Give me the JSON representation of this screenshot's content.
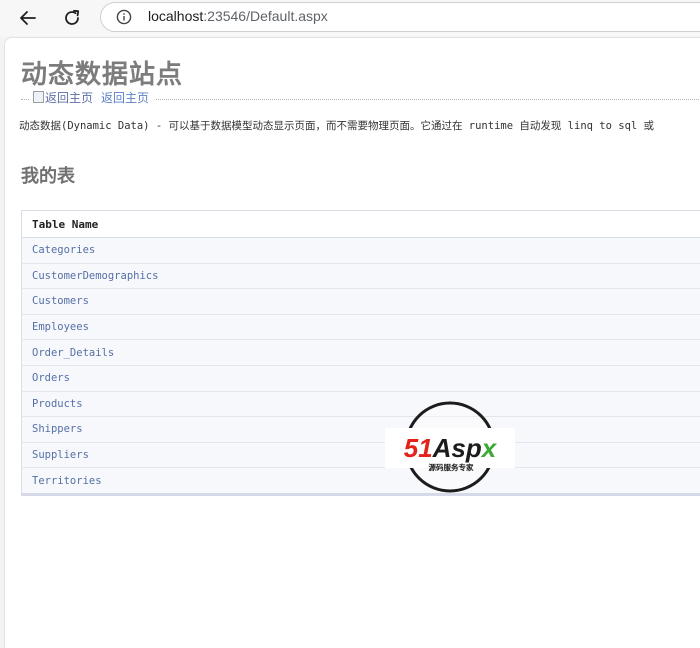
{
  "browser": {
    "url_host": "localhost",
    "url_rest": ":23546/Default.aspx"
  },
  "page": {
    "site_title": "动态数据站点",
    "back_image_alt": "返回主页",
    "back_link": "返回主页",
    "intro": "动态数据(Dynamic Data) - 可以基于数据模型动态显示页面，而不需要物理页面。它通过在 runtime 自动发现 linq to sql 或",
    "section_title": "我的表",
    "table": {
      "header": "Table Name",
      "rows": [
        "Categories",
        "CustomerDemographics",
        "Customers",
        "Employees",
        "Order_Details",
        "Orders",
        "Products",
        "Shippers",
        "Suppliers",
        "Territories"
      ]
    }
  },
  "watermark": {
    "brand": "51Aspx",
    "tagline": "源码服务专家"
  },
  "icons": {
    "back": "arrow-left-icon",
    "reload": "reload-icon",
    "site_info": "info-circle-icon"
  },
  "colors": {
    "link": "#5470a6",
    "title": "#7c7c7c",
    "watermark_red": "#e3231b",
    "watermark_green": "#3aa935"
  }
}
